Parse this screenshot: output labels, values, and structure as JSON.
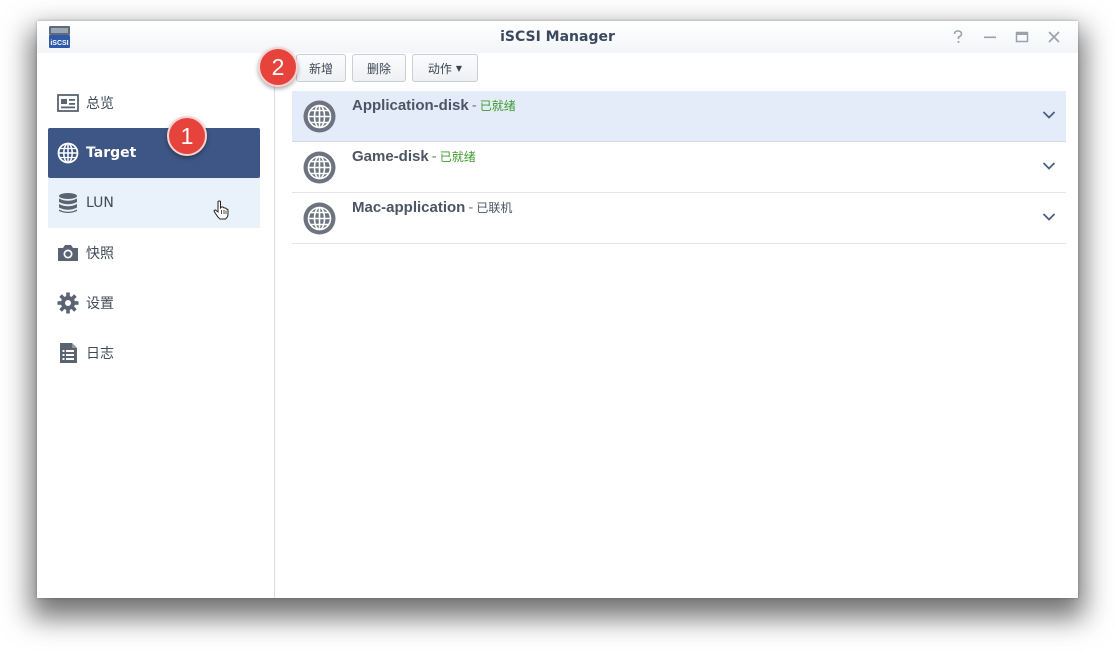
{
  "window": {
    "title": "iSCSI Manager",
    "app_icon_text": "iSCSI"
  },
  "sidebar": {
    "items": [
      {
        "label": "总览",
        "icon": "overview-icon",
        "state": "normal"
      },
      {
        "label": "Target",
        "icon": "globe-icon",
        "state": "active"
      },
      {
        "label": "LUN",
        "icon": "database-icon",
        "state": "hover"
      },
      {
        "label": "快照",
        "icon": "camera-icon",
        "state": "normal"
      },
      {
        "label": "设置",
        "icon": "gear-icon",
        "state": "normal"
      },
      {
        "label": "日志",
        "icon": "log-icon",
        "state": "normal"
      }
    ]
  },
  "badges": [
    "1",
    "2"
  ],
  "toolbar": {
    "add_label": "新增",
    "delete_label": "删除",
    "action_label": "动作"
  },
  "targets": [
    {
      "name": "Application-disk",
      "separator": "-",
      "status": "已就绪",
      "status_type": "ready",
      "selected": true
    },
    {
      "name": "Game-disk",
      "separator": "-",
      "status": "已就绪",
      "status_type": "ready",
      "selected": false
    },
    {
      "name": "Mac-application",
      "separator": "-",
      "status": "已联机",
      "status_type": "online",
      "selected": false
    }
  ],
  "colors": {
    "active_nav": "#3d5685",
    "hover_nav": "#e9f1fb",
    "selected_row": "#e4ecfa",
    "status_ready": "#3f9a2c",
    "badge": "#e6433d"
  }
}
